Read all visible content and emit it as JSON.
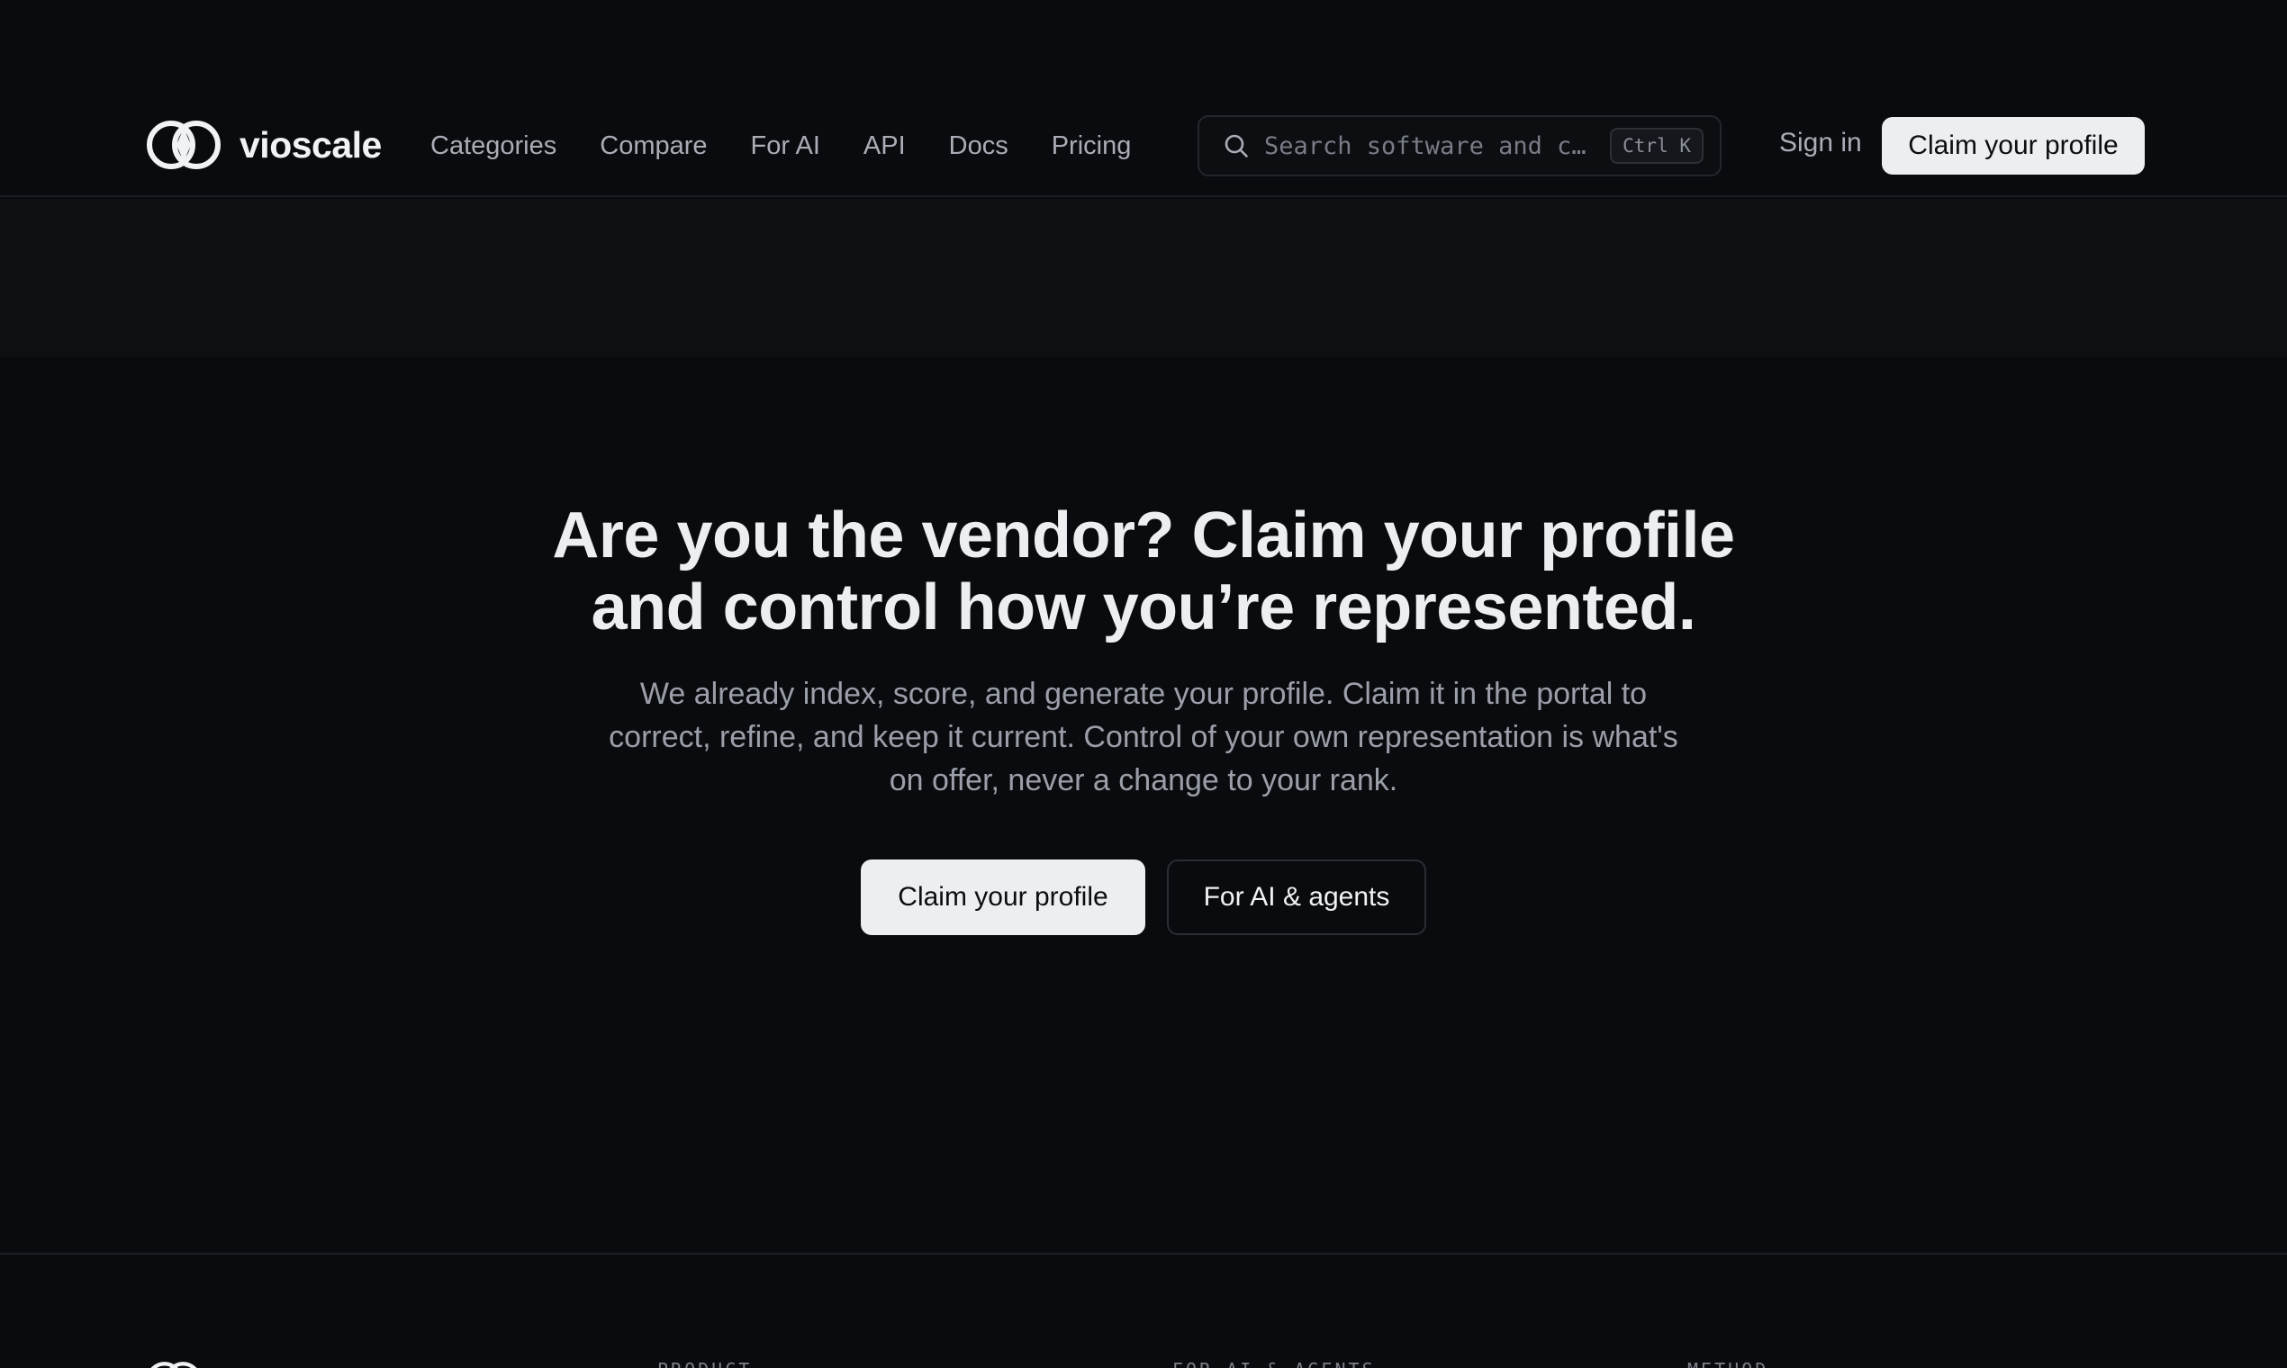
{
  "brand": {
    "name": "vioscale",
    "logo_icon": "interlocking-rings-logo"
  },
  "nav": {
    "items": [
      "Categories",
      "Compare",
      "For AI",
      "API",
      "Docs",
      "Pricing"
    ]
  },
  "search": {
    "icon": "search-icon",
    "placeholder": "Search software and c…",
    "shortcut": "Ctrl K"
  },
  "header": {
    "sign_in": "Sign in",
    "cta": "Claim your profile"
  },
  "hero": {
    "title_line1": "Are you the vendor? Claim your profile",
    "title_line2": "and control how you’re represented.",
    "subtitle": "We already index, score, and generate your profile. Claim it in the portal to correct, refine, and keep it current. Control of your own representation is what's on offer, never a change to your rank.",
    "primary_cta": "Claim your profile",
    "secondary_cta": "For AI & agents"
  },
  "footer": {
    "columns": [
      "PRODUCT",
      "FOR AI & AGENTS",
      "METHOD"
    ]
  },
  "colors": {
    "background": "#0a0b0e",
    "band": "#0e0f12",
    "button_light": "#eceef2",
    "text_primary": "#eceef2",
    "text_muted": "#9a9fa9"
  }
}
